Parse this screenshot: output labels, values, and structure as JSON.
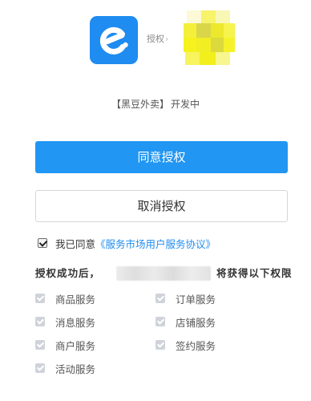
{
  "header": {
    "auth_label": "授权",
    "auth_chevron": "›",
    "app_icon": "eleme-logo-icon",
    "target_icon": "pixelated-logo-icon",
    "colors": {
      "brand": "#1e8cf0",
      "target": "#f6f21c"
    }
  },
  "app": {
    "name": "【黑豆外卖】",
    "status": "开发中"
  },
  "buttons": {
    "agree": "同意授权",
    "cancel": "取消授权"
  },
  "agreement": {
    "checked": true,
    "prefix": "我已同意",
    "link": "《服务市场用户服务协议》"
  },
  "permissions": {
    "heading_prefix": "授权成功后，",
    "heading_suffix": "将获得以下权限",
    "items": [
      {
        "label": "商品服务",
        "checked": true
      },
      {
        "label": "订单服务",
        "checked": true
      },
      {
        "label": "消息服务",
        "checked": true
      },
      {
        "label": "店铺服务",
        "checked": true
      },
      {
        "label": "商户服务",
        "checked": true
      },
      {
        "label": "签约服务",
        "checked": true
      },
      {
        "label": "活动服务",
        "checked": true
      }
    ]
  }
}
